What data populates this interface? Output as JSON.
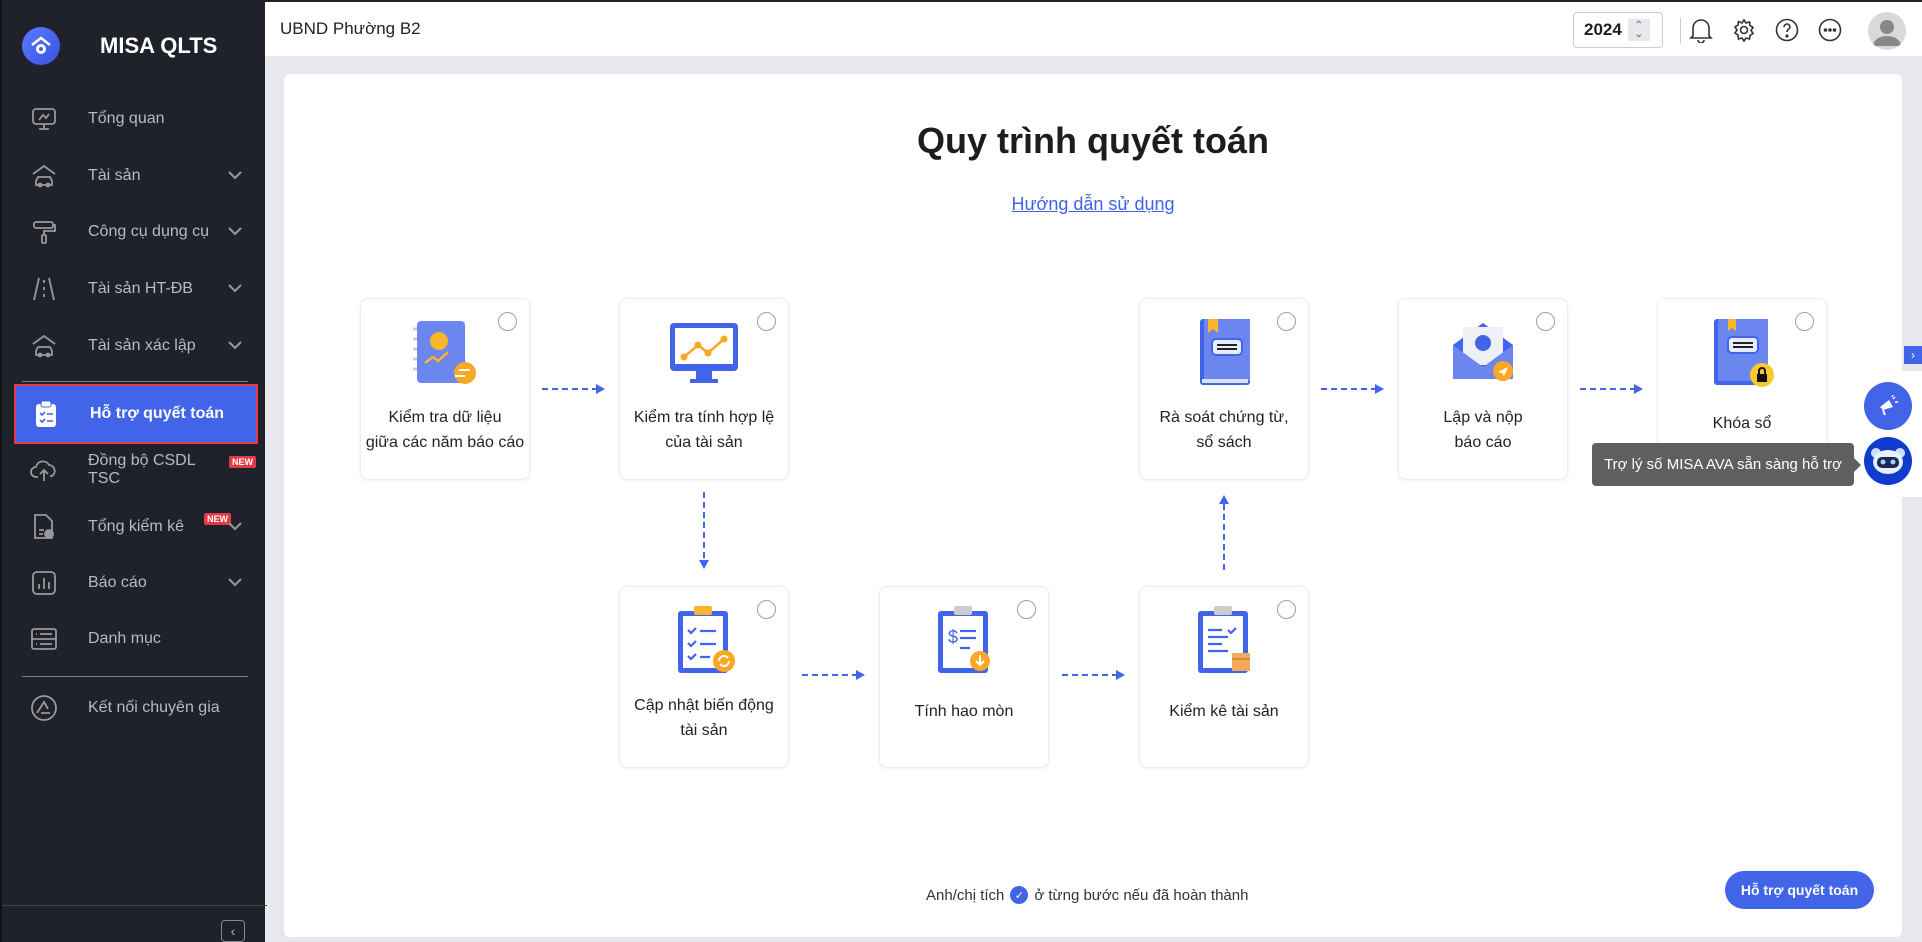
{
  "app": {
    "name": "MISA QLTS"
  },
  "sidebar": {
    "items": [
      {
        "label": "Tổng quan",
        "icon": "monitor-chart-icon",
        "expandable": false
      },
      {
        "label": "Tài sản",
        "icon": "house-car-icon",
        "expandable": true
      },
      {
        "label": "Công cụ dụng cụ",
        "icon": "paint-roller-icon",
        "expandable": true
      },
      {
        "label": "Tài sản HT-ĐB",
        "icon": "road-icon",
        "expandable": true
      },
      {
        "label": "Tài sản xác lập",
        "icon": "house-car-icon",
        "expandable": true
      },
      {
        "label": "Hỗ trợ quyết toán",
        "icon": "clipboard-check-icon",
        "active": true
      },
      {
        "label": "Đồng bộ CSDL TSC",
        "icon": "cloud-upload-icon",
        "badge": "NEW"
      },
      {
        "label": "Tổng kiểm kê",
        "icon": "document-check-icon",
        "badge": "NEW",
        "expandable": true
      },
      {
        "label": "Báo cáo",
        "icon": "bar-chart-icon",
        "expandable": true
      },
      {
        "label": "Danh mục",
        "icon": "list-icon"
      },
      {
        "label": "Kết nối chuyên gia",
        "icon": "expert-icon"
      }
    ]
  },
  "header": {
    "org": "UBND Phường B2",
    "year": "2024"
  },
  "main": {
    "title": "Quy trình quyết toán",
    "guide_link": "Hướng dẫn sử dụng",
    "steps": [
      {
        "line1": "Kiểm tra dữ liệu",
        "line2": "giữa các năm báo cáo",
        "done": false
      },
      {
        "line1": "Kiểm tra tính hợp lệ",
        "line2": "của tài sản",
        "done": false
      },
      {
        "line1": "Cập nhật biến động",
        "line2": "tài sản",
        "done": false
      },
      {
        "line1": "Tính hao mòn",
        "line2": "",
        "done": false
      },
      {
        "line1": "Kiểm kê tài sản",
        "line2": "",
        "done": false
      },
      {
        "line1": "Rà soát chứng từ,",
        "line2": "sổ sách",
        "done": false
      },
      {
        "line1": "Lập và nộp",
        "line2": "báo cáo",
        "done": false
      },
      {
        "line1": "Khóa sổ",
        "line2": "",
        "done": false
      }
    ],
    "note_before": "Anh/chị tích",
    "note_after": "ở từng bước nếu đã hoàn thành",
    "help_button": "Hỗ trợ quyết toán"
  },
  "assistant": {
    "tooltip": "Trợ lý số MISA AVA sẵn sàng hỗ trợ"
  },
  "colors": {
    "accent": "#4164e8",
    "sidebar": "#1f222a",
    "new_badge": "#e53945",
    "icon_orange": "#f9a825"
  }
}
